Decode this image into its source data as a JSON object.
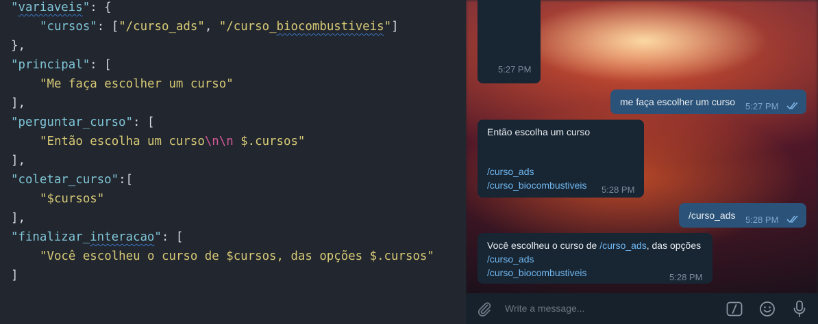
{
  "editor": {
    "lines": [
      {
        "k": "\"variaveis\"",
        "p": ": {"
      },
      {
        "k": "\"cursos\"",
        "p": ": [",
        "s1": "\"/curso_ads\"",
        "p2": ", ",
        "s2": "\"/curso_biocombustiveis\"",
        "p3": "]"
      },
      {
        "p": "},"
      },
      {
        "k": "\"principal\"",
        "p": ": ["
      },
      {
        "s": "\"Me faça escolher um curso\""
      },
      {
        "p": "],"
      },
      {
        "k": "\"perguntar_curso\"",
        "p": ": ["
      },
      {
        "s_a": "\"Então escolha um curso",
        "esc": "\\n\\n",
        "s_b": " $.cursos\""
      },
      {
        "p": "],"
      },
      {
        "k": "\"coletar_curso\"",
        "p": ":["
      },
      {
        "s": "\"$cursos\""
      },
      {
        "p": "],"
      },
      {
        "k": "\"finalizar_interacao\"",
        "p": ": ["
      },
      {
        "s": "\"Você escolheu o curso de $cursos, das opções $.cursos\""
      },
      {
        "p": "]"
      }
    ]
  },
  "chat": {
    "msg1_time": "5:27 PM",
    "msg2_text": "me faça escolher um curso",
    "msg2_time": "5:27 PM",
    "msg3_text": "Então escolha um curso",
    "msg3_link1": "/curso_ads",
    "msg3_link2": "/curso_biocombustiveis",
    "msg3_time": "5:28 PM",
    "msg4_text": "/curso_ads",
    "msg4_time": "5:28 PM",
    "msg5_text_a": "Você escolheu o curso de ",
    "msg5_link_inline": "/curso_ads",
    "msg5_text_b": ", das opções",
    "msg5_link1": "/curso_ads",
    "msg5_link2": "/curso_biocombustiveis",
    "msg5_time": "5:28 PM"
  },
  "composer": {
    "placeholder": "Write a message...",
    "icons": [
      "paperclip-icon",
      "bot-commands-icon",
      "emoji-icon",
      "microphone-icon"
    ]
  }
}
